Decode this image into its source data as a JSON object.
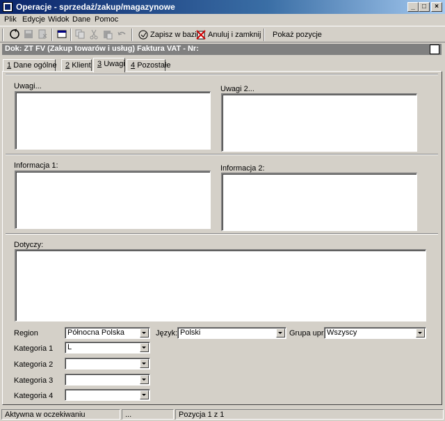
{
  "window": {
    "title": "Operacje - sprzedaż/zakup/magazynowe"
  },
  "menu": [
    "Plik",
    "Edycje",
    "Widok",
    "Dane",
    "Pomoc"
  ],
  "toolbar": {
    "save_label": "Zapisz w bazie",
    "cancel_label": "Anuluj i zamknij",
    "show_items_label": "Pokaż pozycje"
  },
  "doc_header": {
    "text": "Dok: ZT FV (Zakup towarów i usług)  Faktura VAT  -  Nr:"
  },
  "tabs": [
    {
      "num": "1",
      "label": "Dane ogólne"
    },
    {
      "num": "2",
      "label": "Klient"
    },
    {
      "num": "3",
      "label": "Uwagi"
    },
    {
      "num": "4",
      "label": "Pozostałe"
    }
  ],
  "active_tab": "Uwagi",
  "fields": {
    "uwagi_label": "Uwagi...",
    "uwagi2_label": "Uwagi 2...",
    "info1_label": "Informacja 1:",
    "info2_label": "Informacja 2:",
    "dotyczy_label": "Dotyczy:",
    "uwagi_value": "",
    "uwagi2_value": "",
    "info1_value": "",
    "info2_value": "",
    "dotyczy_value": ""
  },
  "selects": {
    "region": {
      "label": "Region",
      "value": "Północna Polska"
    },
    "jezyk": {
      "label": "Język:",
      "value": "Polski"
    },
    "grupa": {
      "label": "Grupa upr.",
      "value": "Wszyscy"
    },
    "kat1": {
      "label": "Kategoria 1",
      "value": "L"
    },
    "kat2": {
      "label": "Kategoria 2",
      "value": ""
    },
    "kat3": {
      "label": "Kategoria 3",
      "value": ""
    },
    "kat4": {
      "label": "Kategoria 4",
      "value": ""
    }
  },
  "status": {
    "state": "Aktywna w oczekiwaniu",
    "middle": "...",
    "position": "Pozycja 1 z 1"
  }
}
